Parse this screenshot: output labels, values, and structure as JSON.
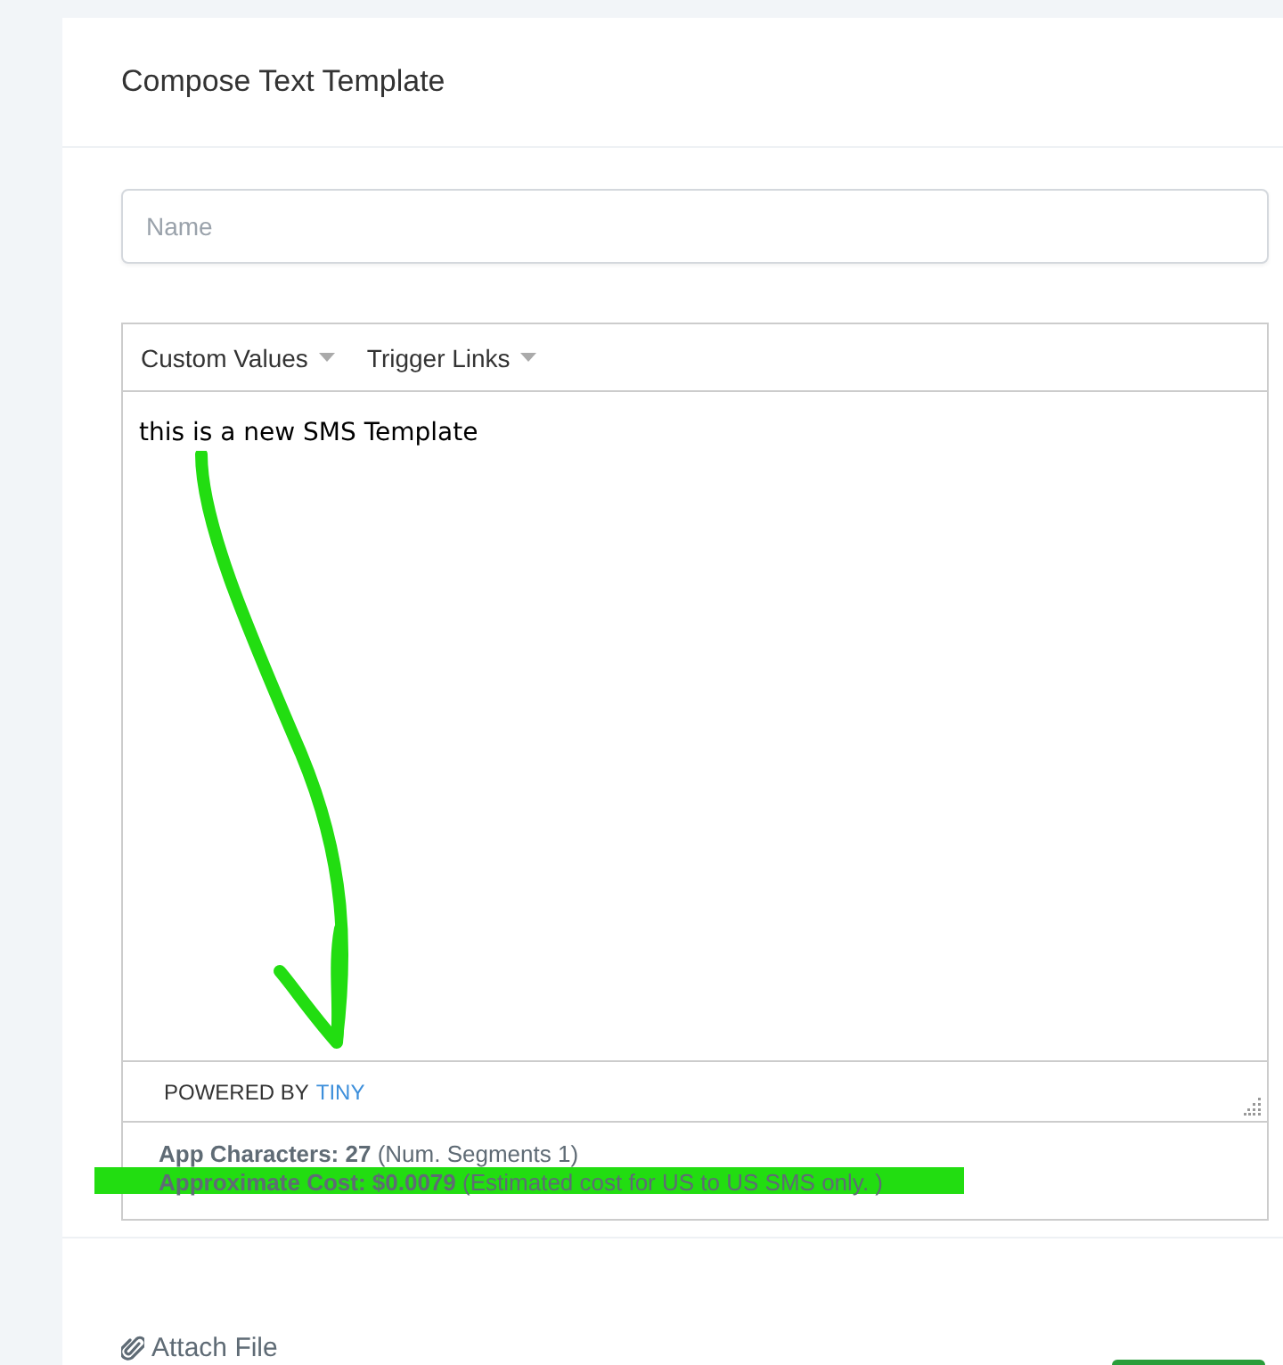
{
  "card": {
    "title": "Compose Text Template"
  },
  "name_field": {
    "placeholder": "Name"
  },
  "editor": {
    "menus": [
      {
        "label": "Custom Values"
      },
      {
        "label": "Trigger Links"
      }
    ],
    "content": "this is a new SMS Template",
    "powered_by": "POWERED BY",
    "brand_link": "TINY"
  },
  "stats": [
    {
      "text": "**App Characters: 27** (Num. Segments 1)",
      "highlighted": false
    },
    {
      "text": "**Approximate Cost: $0.0079** (Estimated cost for US to US SMS only. )",
      "highlighted": true
    }
  ],
  "attach": {
    "label": "Attach File"
  }
}
